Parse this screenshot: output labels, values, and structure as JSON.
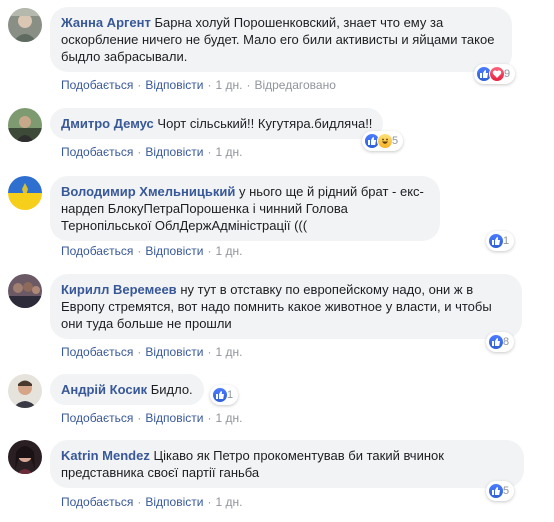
{
  "actions": {
    "like": "Подобається",
    "reply": "Відповісти",
    "separator": "·"
  },
  "colors": {
    "link": "#385898",
    "bubble": "#f2f3f5",
    "like_reaction": "#2d5fd6",
    "love_reaction": "#e61e3e",
    "haha_reaction": "#f7b125"
  },
  "comments": [
    {
      "author": "Жанна Аргент",
      "text": "Барна холуй Порошенковский, знает что ему за оскорбление ничего не будет. Мало его били активисты и яйцами такое быдло забрасывали.",
      "time": "1 дн.",
      "edited": "Відредаговано",
      "reactions": [
        "like-icon",
        "love-icon"
      ],
      "reaction_count": "9"
    },
    {
      "author": "Дмитро Демус",
      "text": "Чорт сільський!! Кугутяра.бидляча!!",
      "time": "1 дн.",
      "reactions": [
        "like-icon",
        "haha-icon"
      ],
      "reaction_count": "5"
    },
    {
      "author": "Володимир Хмельницький",
      "text": "у нього ще й рідний брат - екс-нардеп БлокуПетраПорошенка і чинний Голова Тернопільської ОблДержАдміністрації (((",
      "time": "1 дн.",
      "reactions": [
        "like-icon"
      ],
      "reaction_count": "1"
    },
    {
      "author": "Кирилл Веремеев",
      "text": "ну тут в отставку по европейскому надо, они ж в Европу стремятся, вот надо помнить какое животное у власти, и чтобы они туда больше не прошли",
      "time": "1 дн.",
      "reactions": [
        "like-icon"
      ],
      "reaction_count": "8"
    },
    {
      "author": "Андрій Косик",
      "text": "Бидло.",
      "time": "1 дн.",
      "reactions": [
        "like-icon"
      ],
      "reaction_count": "1"
    },
    {
      "author": "Katrin Mendez",
      "text": "Цікаво як Петро прокоментував би такий вчинок представника своєї партії ганьба",
      "time": "1 дн.",
      "reactions": [
        "like-icon"
      ],
      "reaction_count": "5"
    }
  ]
}
